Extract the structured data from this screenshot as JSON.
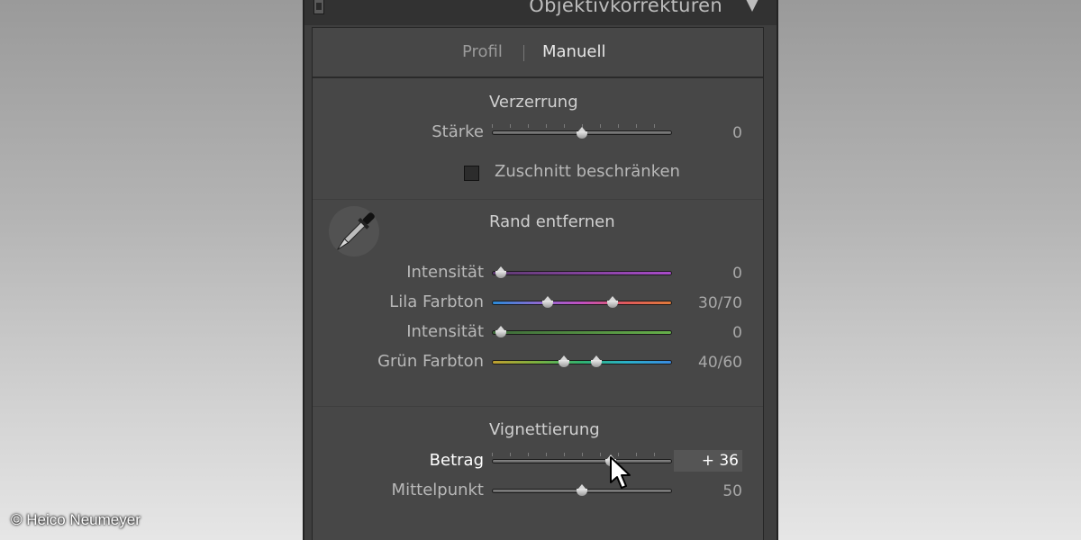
{
  "panel": {
    "title": "Objektivkorrekturen",
    "collapse_icon": "triangle-down-icon"
  },
  "tabs": [
    {
      "label": "Profil",
      "active": false
    },
    {
      "label": "Manuell",
      "active": true
    }
  ],
  "verzerrung": {
    "title": "Verzerrung",
    "staerke": {
      "label": "Stärke",
      "value": "0",
      "position": 0.5
    },
    "checkbox_label": "Zuschnitt beschränken",
    "checked": false
  },
  "rand": {
    "title": "Rand entfernen",
    "tool_icon": "eyedropper-icon",
    "rows": [
      {
        "label": "Intensität",
        "value": "0",
        "positions": [
          0.05
        ],
        "track": "purple"
      },
      {
        "label": "Lila Farbton",
        "value": "30/70",
        "positions": [
          0.3,
          0.7
        ],
        "track": "lila"
      },
      {
        "label": "Intensität",
        "value": "0",
        "positions": [
          0.05
        ],
        "track": "green"
      },
      {
        "label": "Grün Farbton",
        "value": "40/60",
        "positions": [
          0.4,
          0.58
        ],
        "track": "gruen"
      }
    ]
  },
  "vignettierung": {
    "title": "Vignettierung",
    "betrag": {
      "label": "Betrag",
      "value": "+ 36",
      "position": 0.68
    },
    "mittelpunkt": {
      "label": "Mittelpunkt",
      "value": "50",
      "position": 0.5
    }
  },
  "credit": "© Heico Neumeyer"
}
